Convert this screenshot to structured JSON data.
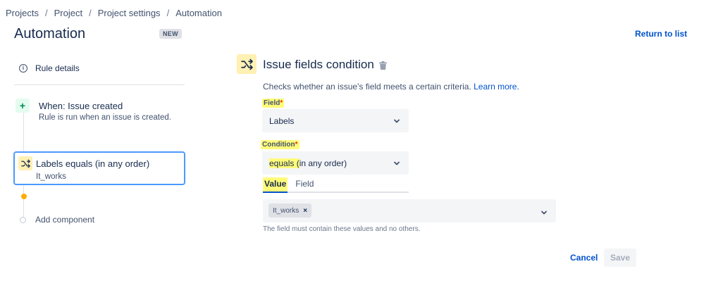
{
  "breadcrumb": [
    "Projects",
    "Project",
    "Project settings",
    "Automation"
  ],
  "breadcrumb_separator": "/",
  "page": {
    "title": "Automation",
    "badge": "NEW",
    "return_link": "Return to list"
  },
  "sidebar": {
    "rule_details": "Rule details",
    "trigger": {
      "title": "When: Issue created",
      "subtitle": "Rule is run when an issue is created."
    },
    "condition": {
      "title": "Labels equals (in any order)",
      "subtitle": "It_works"
    },
    "add_component": "Add component"
  },
  "panel": {
    "title": "Issue fields condition",
    "description": "Checks whether an issue's field meets a certain criteria.",
    "learn_more": "Learn more.",
    "field_label": "Field",
    "field_value": "Labels",
    "condition_label": "Condition",
    "condition_value_highlight": "equals (",
    "condition_value_rest": "in any order)",
    "required_mark": "*",
    "tabs": [
      "Value",
      "Field"
    ],
    "chip": "It_works",
    "helper": "The field must contain these values and no others."
  },
  "actions": {
    "cancel": "Cancel",
    "save": "Save"
  },
  "colors": {
    "link": "#0052cc",
    "highlight": "#fffb7a",
    "focus_border": "#4c9aff",
    "trigger_green": "#00875a",
    "condition_yellow": "#fff0b3",
    "timeline_dot": "#ffab00"
  },
  "icons": [
    "info-icon",
    "plus-icon",
    "shuffle-icon",
    "trash-icon",
    "chevron-down-icon",
    "close-icon"
  ]
}
